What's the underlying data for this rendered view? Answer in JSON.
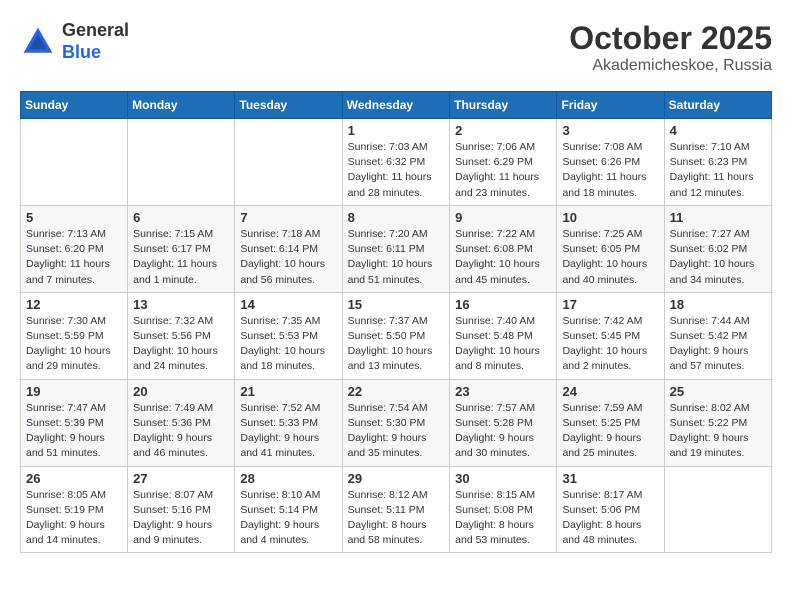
{
  "header": {
    "logo_line1": "General",
    "logo_line2": "Blue",
    "month": "October 2025",
    "location": "Akademicheskoe, Russia"
  },
  "weekdays": [
    "Sunday",
    "Monday",
    "Tuesday",
    "Wednesday",
    "Thursday",
    "Friday",
    "Saturday"
  ],
  "weeks": [
    [
      {
        "day": null
      },
      {
        "day": null
      },
      {
        "day": null
      },
      {
        "day": "1",
        "sunrise": "7:03 AM",
        "sunset": "6:32 PM",
        "daylight": "11 hours and 28 minutes."
      },
      {
        "day": "2",
        "sunrise": "7:06 AM",
        "sunset": "6:29 PM",
        "daylight": "11 hours and 23 minutes."
      },
      {
        "day": "3",
        "sunrise": "7:08 AM",
        "sunset": "6:26 PM",
        "daylight": "11 hours and 18 minutes."
      },
      {
        "day": "4",
        "sunrise": "7:10 AM",
        "sunset": "6:23 PM",
        "daylight": "11 hours and 12 minutes."
      }
    ],
    [
      {
        "day": "5",
        "sunrise": "7:13 AM",
        "sunset": "6:20 PM",
        "daylight": "11 hours and 7 minutes."
      },
      {
        "day": "6",
        "sunrise": "7:15 AM",
        "sunset": "6:17 PM",
        "daylight": "11 hours and 1 minute."
      },
      {
        "day": "7",
        "sunrise": "7:18 AM",
        "sunset": "6:14 PM",
        "daylight": "10 hours and 56 minutes."
      },
      {
        "day": "8",
        "sunrise": "7:20 AM",
        "sunset": "6:11 PM",
        "daylight": "10 hours and 51 minutes."
      },
      {
        "day": "9",
        "sunrise": "7:22 AM",
        "sunset": "6:08 PM",
        "daylight": "10 hours and 45 minutes."
      },
      {
        "day": "10",
        "sunrise": "7:25 AM",
        "sunset": "6:05 PM",
        "daylight": "10 hours and 40 minutes."
      },
      {
        "day": "11",
        "sunrise": "7:27 AM",
        "sunset": "6:02 PM",
        "daylight": "10 hours and 34 minutes."
      }
    ],
    [
      {
        "day": "12",
        "sunrise": "7:30 AM",
        "sunset": "5:59 PM",
        "daylight": "10 hours and 29 minutes."
      },
      {
        "day": "13",
        "sunrise": "7:32 AM",
        "sunset": "5:56 PM",
        "daylight": "10 hours and 24 minutes."
      },
      {
        "day": "14",
        "sunrise": "7:35 AM",
        "sunset": "5:53 PM",
        "daylight": "10 hours and 18 minutes."
      },
      {
        "day": "15",
        "sunrise": "7:37 AM",
        "sunset": "5:50 PM",
        "daylight": "10 hours and 13 minutes."
      },
      {
        "day": "16",
        "sunrise": "7:40 AM",
        "sunset": "5:48 PM",
        "daylight": "10 hours and 8 minutes."
      },
      {
        "day": "17",
        "sunrise": "7:42 AM",
        "sunset": "5:45 PM",
        "daylight": "10 hours and 2 minutes."
      },
      {
        "day": "18",
        "sunrise": "7:44 AM",
        "sunset": "5:42 PM",
        "daylight": "9 hours and 57 minutes."
      }
    ],
    [
      {
        "day": "19",
        "sunrise": "7:47 AM",
        "sunset": "5:39 PM",
        "daylight": "9 hours and 51 minutes."
      },
      {
        "day": "20",
        "sunrise": "7:49 AM",
        "sunset": "5:36 PM",
        "daylight": "9 hours and 46 minutes."
      },
      {
        "day": "21",
        "sunrise": "7:52 AM",
        "sunset": "5:33 PM",
        "daylight": "9 hours and 41 minutes."
      },
      {
        "day": "22",
        "sunrise": "7:54 AM",
        "sunset": "5:30 PM",
        "daylight": "9 hours and 35 minutes."
      },
      {
        "day": "23",
        "sunrise": "7:57 AM",
        "sunset": "5:28 PM",
        "daylight": "9 hours and 30 minutes."
      },
      {
        "day": "24",
        "sunrise": "7:59 AM",
        "sunset": "5:25 PM",
        "daylight": "9 hours and 25 minutes."
      },
      {
        "day": "25",
        "sunrise": "8:02 AM",
        "sunset": "5:22 PM",
        "daylight": "9 hours and 19 minutes."
      }
    ],
    [
      {
        "day": "26",
        "sunrise": "8:05 AM",
        "sunset": "5:19 PM",
        "daylight": "9 hours and 14 minutes."
      },
      {
        "day": "27",
        "sunrise": "8:07 AM",
        "sunset": "5:16 PM",
        "daylight": "9 hours and 9 minutes."
      },
      {
        "day": "28",
        "sunrise": "8:10 AM",
        "sunset": "5:14 PM",
        "daylight": "9 hours and 4 minutes."
      },
      {
        "day": "29",
        "sunrise": "8:12 AM",
        "sunset": "5:11 PM",
        "daylight": "8 hours and 58 minutes."
      },
      {
        "day": "30",
        "sunrise": "8:15 AM",
        "sunset": "5:08 PM",
        "daylight": "8 hours and 53 minutes."
      },
      {
        "day": "31",
        "sunrise": "8:17 AM",
        "sunset": "5:06 PM",
        "daylight": "8 hours and 48 minutes."
      },
      {
        "day": null
      }
    ]
  ],
  "labels": {
    "sunrise_prefix": "Sunrise: ",
    "sunset_prefix": "Sunset: ",
    "daylight_prefix": "Daylight: "
  }
}
